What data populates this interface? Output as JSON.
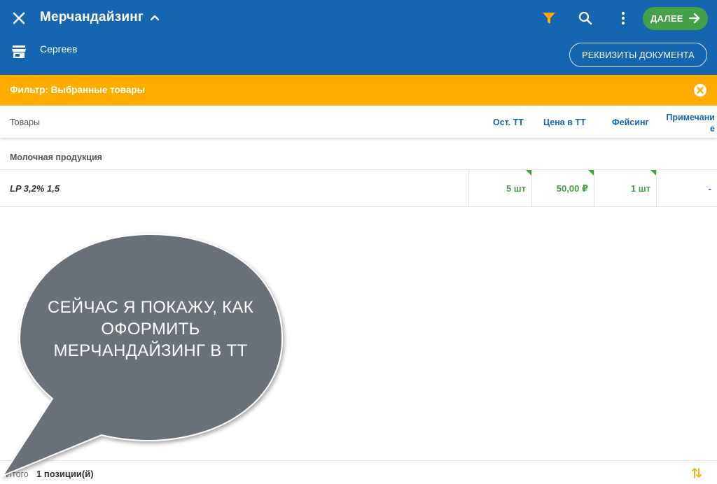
{
  "header": {
    "title": "Мерчандайзинг",
    "subtitle": "Сергеев",
    "next_label": "ДАЛЕЕ",
    "doc_details_label": "РЕКВИЗИТЫ ДОКУМЕНТА"
  },
  "filter": {
    "text": "Фильтр: Выбранные товары"
  },
  "table": {
    "columns": {
      "goods": "Товары",
      "rest": "Ост. ТТ",
      "price": "Цена в ТТ",
      "facing": "Фейсинг",
      "note": "Примечание"
    },
    "group": "Молочная продукция",
    "row": {
      "name": "LP 3,2% 1,5",
      "rest": "5 шт",
      "price": "50,00 ₽",
      "facing": "1 шт",
      "note": "-"
    }
  },
  "footer": {
    "total_label": "Итого",
    "total_value": "1 позиции(й)"
  },
  "overlay": {
    "bubble_text": "СЕЙЧАС Я ПОКАЖУ, КАК ОФОРМИТЬ МЕРЧАНДАЙЗИНГ В ТТ"
  },
  "colors": {
    "primary": "#1565b0",
    "accent_green": "#43a047",
    "filter_banner": "#ffab00",
    "bubble": "#6b7078"
  }
}
